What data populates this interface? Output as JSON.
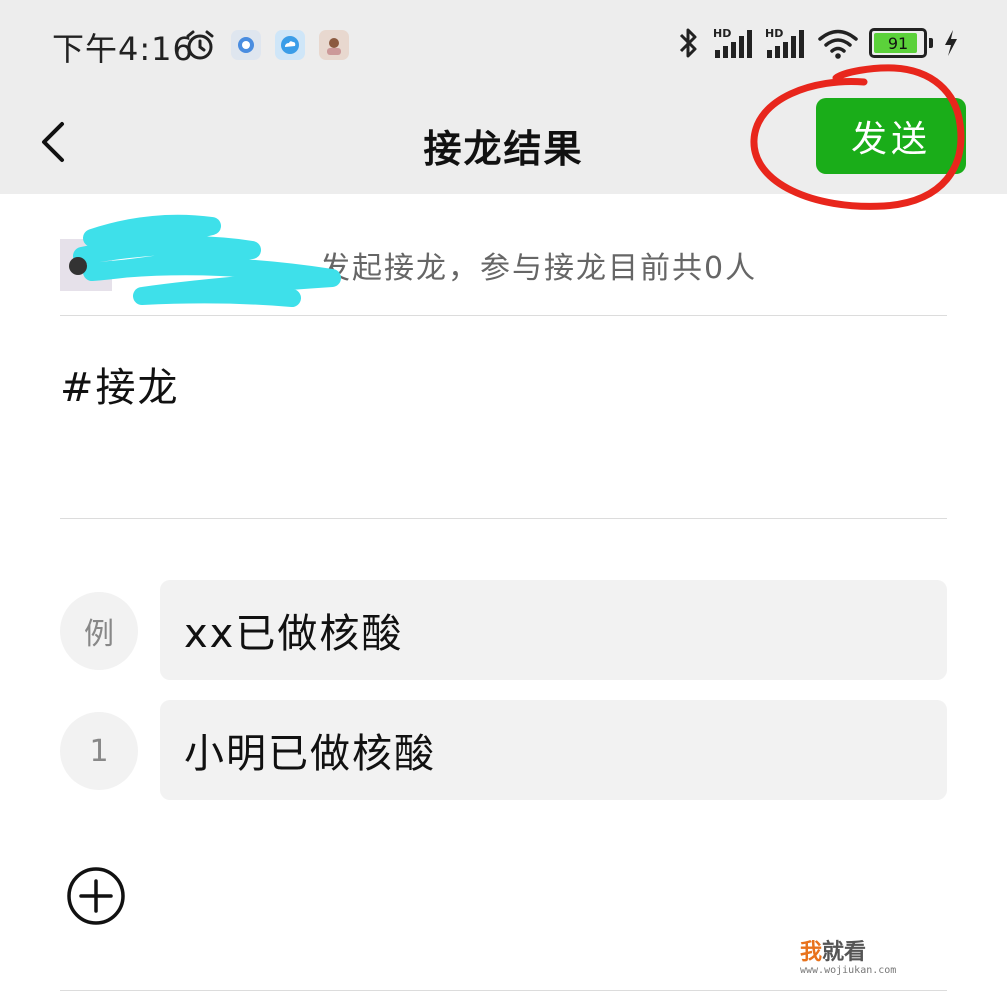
{
  "status_bar": {
    "time": "下午4:16",
    "battery_level": 91,
    "battery_label": "91",
    "network_labels": [
      "HD",
      "HD"
    ]
  },
  "nav": {
    "title": "接龙结果",
    "send_label": "发送",
    "back_icon": "chevron-left-icon"
  },
  "initiator": {
    "text": "发起接龙，参与接龙目前共0人"
  },
  "topic": "#接龙",
  "entries": [
    {
      "index_label": "例",
      "text": "xx已做核酸"
    },
    {
      "index_label": "1",
      "text": "小明已做核酸"
    }
  ],
  "add_icon": "plus-circle-icon",
  "watermark": {
    "accent": "我",
    "main": "就看",
    "url": "www.wojiukan.com"
  },
  "colors": {
    "send_button": "#1aad19",
    "annotation_circle": "#e8261c",
    "redaction_scribble": "#3ee0ea",
    "header_bg": "#ededed"
  }
}
